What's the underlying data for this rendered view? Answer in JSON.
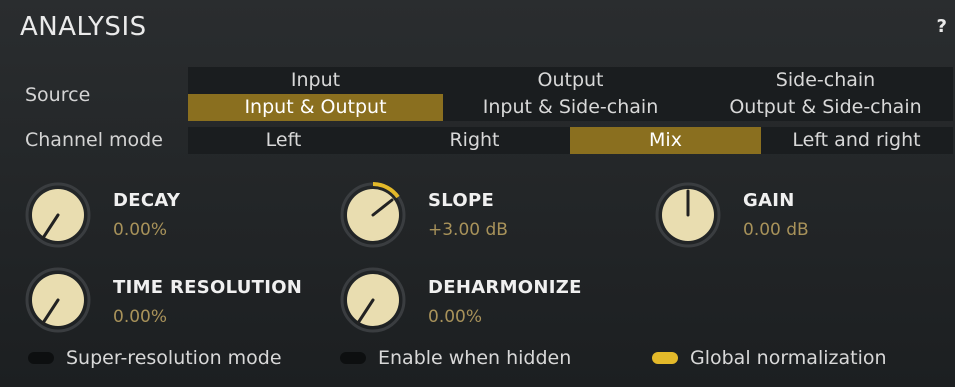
{
  "header": {
    "title": "ANALYSIS",
    "help": "?"
  },
  "source": {
    "label": "Source",
    "options": [
      "Input",
      "Output",
      "Side-chain",
      "Input & Output",
      "Input & Side-chain",
      "Output & Side-chain"
    ],
    "selected": "Input & Output"
  },
  "channel_mode": {
    "label": "Channel mode",
    "options": [
      "Left",
      "Right",
      "Mix",
      "Left and right"
    ],
    "selected": "Mix"
  },
  "knobs": {
    "decay": {
      "title": "DECAY",
      "value": "0.00%",
      "level": 0
    },
    "slope": {
      "title": "SLOPE",
      "value": "+3.00 dB",
      "level": 0.65
    },
    "gain": {
      "title": "GAIN",
      "value": "0.00 dB",
      "level": 0.5
    },
    "time_resolution": {
      "title": "TIME RESOLUTION",
      "value": "0.00%",
      "level": 0
    },
    "deharmonize": {
      "title": "DEHARMONIZE",
      "value": "0.00%",
      "level": 0
    }
  },
  "toggles": {
    "super_resolution": {
      "label": "Super-resolution mode",
      "on": false
    },
    "enable_hidden": {
      "label": "Enable when hidden",
      "on": false
    },
    "global_norm": {
      "label": "Global normalization",
      "on": true
    }
  },
  "colors": {
    "accent": "#8a6f1f",
    "toggle_on": "#e3b92a",
    "value_text": "#a8925a"
  }
}
